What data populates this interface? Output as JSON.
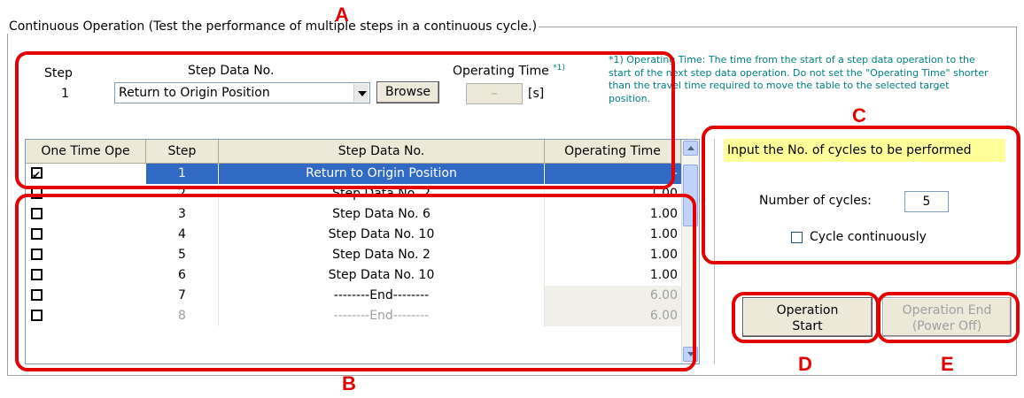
{
  "group_title": "Continuous Operation (Test the performance of multiple steps in a continuous cycle.)",
  "callouts": {
    "a": "A",
    "b": "B",
    "c": "C",
    "d": "D",
    "e": "E"
  },
  "editor": {
    "step_label": "Step",
    "step_value": "1",
    "step_data_label": "Step Data No.",
    "operating_time_label": "Operating Time",
    "operating_time_sup": "*1)",
    "combo_value": "Return to Origin Position",
    "browse_label": "Browse",
    "operating_time_value": "–",
    "unit": "[s]"
  },
  "note": "*1) Operating Time: The time from the start of a step data operation to the start of the next step data operation. Do not set the \"Operating Time\" shorter than the travel time required to move the table to the selected target position.",
  "table": {
    "columns": [
      "One Time Ope",
      "Step",
      "Step Data No.",
      "Operating Time"
    ],
    "rows": [
      {
        "checked": true,
        "step": "1",
        "data": "Return to Origin Position",
        "time": "–",
        "selected": true,
        "disabled": false
      },
      {
        "checked": false,
        "step": "2",
        "data": "Step Data No. 2",
        "time": "1.00",
        "selected": false,
        "disabled": false
      },
      {
        "checked": false,
        "step": "3",
        "data": "Step Data No. 6",
        "time": "1.00",
        "selected": false,
        "disabled": false
      },
      {
        "checked": false,
        "step": "4",
        "data": "Step Data No. 10",
        "time": "1.00",
        "selected": false,
        "disabled": false
      },
      {
        "checked": false,
        "step": "5",
        "data": "Step Data No. 2",
        "time": "1.00",
        "selected": false,
        "disabled": false
      },
      {
        "checked": false,
        "step": "6",
        "data": "Step Data No. 10",
        "time": "1.00",
        "selected": false,
        "disabled": false
      },
      {
        "checked": false,
        "step": "7",
        "data": "--------End--------",
        "time": "6.00",
        "selected": false,
        "disabled": false,
        "time_gray": true
      },
      {
        "checked": false,
        "step": "8",
        "data": "--------End--------",
        "time": "6.00",
        "selected": false,
        "disabled": true,
        "time_gray": true
      }
    ]
  },
  "cycles": {
    "hint": "Input the No. of cycles to be performed",
    "label": "Number of cycles:",
    "value": "5",
    "continuous_label": "Cycle continuously",
    "continuous_checked": false
  },
  "buttons": {
    "start_line1": "Operation",
    "start_line2": "Start",
    "end_line1": "Operation End",
    "end_line2": "(Power Off)"
  },
  "icons": [
    "combo-dropdown-icon",
    "scroll-up-icon",
    "scroll-down-icon",
    "checkbox-icon"
  ],
  "colors": {
    "selection": "#316ac5",
    "callout": "#e30000",
    "note": "#008080",
    "hint_bg": "#ffff99"
  }
}
